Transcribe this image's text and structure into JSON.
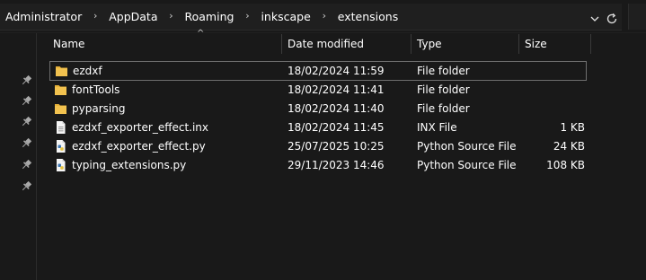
{
  "breadcrumb": [
    "Administrator",
    "AppData",
    "Roaming",
    "inkscape",
    "extensions"
  ],
  "breadcrumb_separator": "›",
  "columns": {
    "name": "Name",
    "date_modified": "Date modified",
    "type": "Type",
    "size": "Size"
  },
  "sort_indicator": "^",
  "files": [
    {
      "name": "ezdxf",
      "date": "18/02/2024 11:59",
      "type": "File folder",
      "size": "",
      "icon": "folder-icon"
    },
    {
      "name": "fontTools",
      "date": "18/02/2024 11:41",
      "type": "File folder",
      "size": "",
      "icon": "folder-icon"
    },
    {
      "name": "pyparsing",
      "date": "18/02/2024 11:40",
      "type": "File folder",
      "size": "",
      "icon": "folder-icon"
    },
    {
      "name": "ezdxf_exporter_effect.inx",
      "date": "18/02/2024 11:45",
      "type": "INX File",
      "size": "1 KB",
      "icon": "document-icon"
    },
    {
      "name": "ezdxf_exporter_effect.py",
      "date": "25/07/2025 10:25",
      "type": "Python Source File",
      "size": "24 KB",
      "icon": "python-file-icon"
    },
    {
      "name": "typing_extensions.py",
      "date": "29/11/2023 14:46",
      "type": "Python Source File",
      "size": "108 KB",
      "icon": "python-file-icon"
    }
  ],
  "colors": {
    "background": "#191919",
    "folder": "#e8b33a",
    "text": "#ffffff",
    "selection_border": "#6e6e6e"
  }
}
